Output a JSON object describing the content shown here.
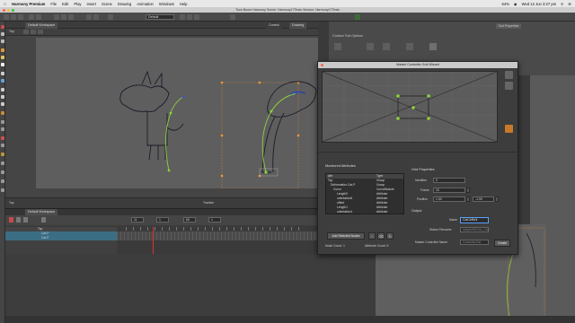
{
  "menubar": {
    "app": "Harmony Premium",
    "items": [
      "File",
      "Edit",
      "Play",
      "Insert",
      "Scene",
      "Drawing",
      "Animation",
      "Windows",
      "Help"
    ],
    "clock": "Wed 12 Jun 3:27 pm",
    "battery": "64%"
  },
  "window": {
    "title": "Toon Boom Harmony Scene: Harmony17Tests Version: Harmony17Tests"
  },
  "toolbar": {
    "view_combo": "Default"
  },
  "camera": {
    "tabs": [
      "Camera"
    ],
    "top_tabs": [
      "Default Workspace"
    ],
    "view_name": "Top",
    "status_left": "Top",
    "status_mid": "Traction",
    "right_tabs": [
      "Control",
      "Drawing"
    ]
  },
  "right_panel": {
    "tab": "Tool Properties",
    "label": "Contour Tool Options"
  },
  "dialog": {
    "title": "Master Controller Grid Wizard",
    "attributes": {
      "heading": "Monitored Attributes",
      "col_name": "Attr",
      "col_type": "Type",
      "rows": [
        {
          "name": "Top",
          "type": "Group"
        },
        {
          "name": "Deformation-Cat-P",
          "type": "Group"
        },
        {
          "name": "Curve",
          "type": "CurveModule"
        },
        {
          "name": "Length0",
          "type": "Attribute"
        },
        {
          "name": "orientation0",
          "type": "Attribute"
        },
        {
          "name": "offset",
          "type": "Attribute"
        },
        {
          "name": "Length1",
          "type": "Attribute"
        },
        {
          "name": "orientation1",
          "type": "Attribute"
        }
      ],
      "add_button": "Add Selected Nodes",
      "node_count": "Node Count: 1",
      "attr_count": "Attribute Count: 5"
    },
    "grid_props": {
      "heading": "Grid Properties",
      "identifier_label": "Identifier",
      "identifier": "0",
      "frame_label": "Frame",
      "frame": "10",
      "position_label": "Position",
      "pos_x": "1.00",
      "pos_y": "-1.00"
    },
    "output": {
      "heading": "Output",
      "name_label": "Name",
      "name": "CatCtrlBell",
      "status_label": "Status Filename",
      "status": "scripts/MC/mc_Cat",
      "mc_name_label": "Master Controller Name",
      "mc_name": "ControllerCat",
      "create_button": "Create"
    },
    "grid_points": [
      "0,0",
      "1,0",
      "-1,0",
      "0,1",
      "0,-1"
    ]
  },
  "timeline": {
    "tabs": [
      "Default Workspace"
    ],
    "fields": [
      "11",
      "1",
      "60",
      "1"
    ],
    "layers": [
      {
        "name": "Top"
      },
      {
        "name": "Cat-P"
      },
      {
        "name": "Cat-P"
      }
    ]
  },
  "colors": {
    "accent_green": "#8ed23a",
    "controller_orange": "#ff9a2e",
    "deform_blue": "#3a54c8",
    "selection": "#5aa0ff"
  }
}
